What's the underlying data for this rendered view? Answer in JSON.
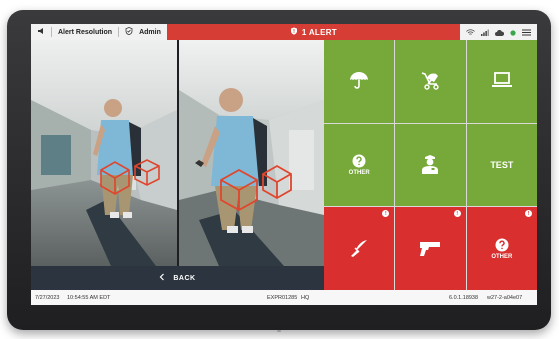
{
  "topbar": {
    "section_label": "Alert Resolution",
    "role_label": "Admin",
    "alert_label": "1 ALERT"
  },
  "cameras": {
    "back_label": "BACK"
  },
  "tiles": [
    {
      "icon": "umbrella-icon",
      "label": "",
      "color": "#77a93a",
      "badge": ""
    },
    {
      "icon": "stroller-icon",
      "label": "",
      "color": "#77a93a",
      "badge": ""
    },
    {
      "icon": "laptop-icon",
      "label": "",
      "color": "#77a93a",
      "badge": ""
    },
    {
      "icon": "question-icon",
      "label": "OTHER",
      "color": "#77a93a",
      "badge": ""
    },
    {
      "icon": "guard-icon",
      "label": "",
      "color": "#77a93a",
      "badge": ""
    },
    {
      "icon": "",
      "label": "TEST",
      "color": "#77a93a",
      "badge": ""
    },
    {
      "icon": "knife-icon",
      "label": "",
      "color": "#d92f2f",
      "badge": "!"
    },
    {
      "icon": "gun-icon",
      "label": "",
      "color": "#d92f2f",
      "badge": "!"
    },
    {
      "icon": "question-icon",
      "label": "OTHER",
      "color": "#d92f2f",
      "badge": "!"
    }
  ],
  "status": {
    "date": "7/27/2023",
    "time": "10:54:55 AM EDT",
    "device_id": "EXPR01285",
    "location": "HQ",
    "version": "6.0.1.18938",
    "build": "w27-2-a04e07"
  }
}
